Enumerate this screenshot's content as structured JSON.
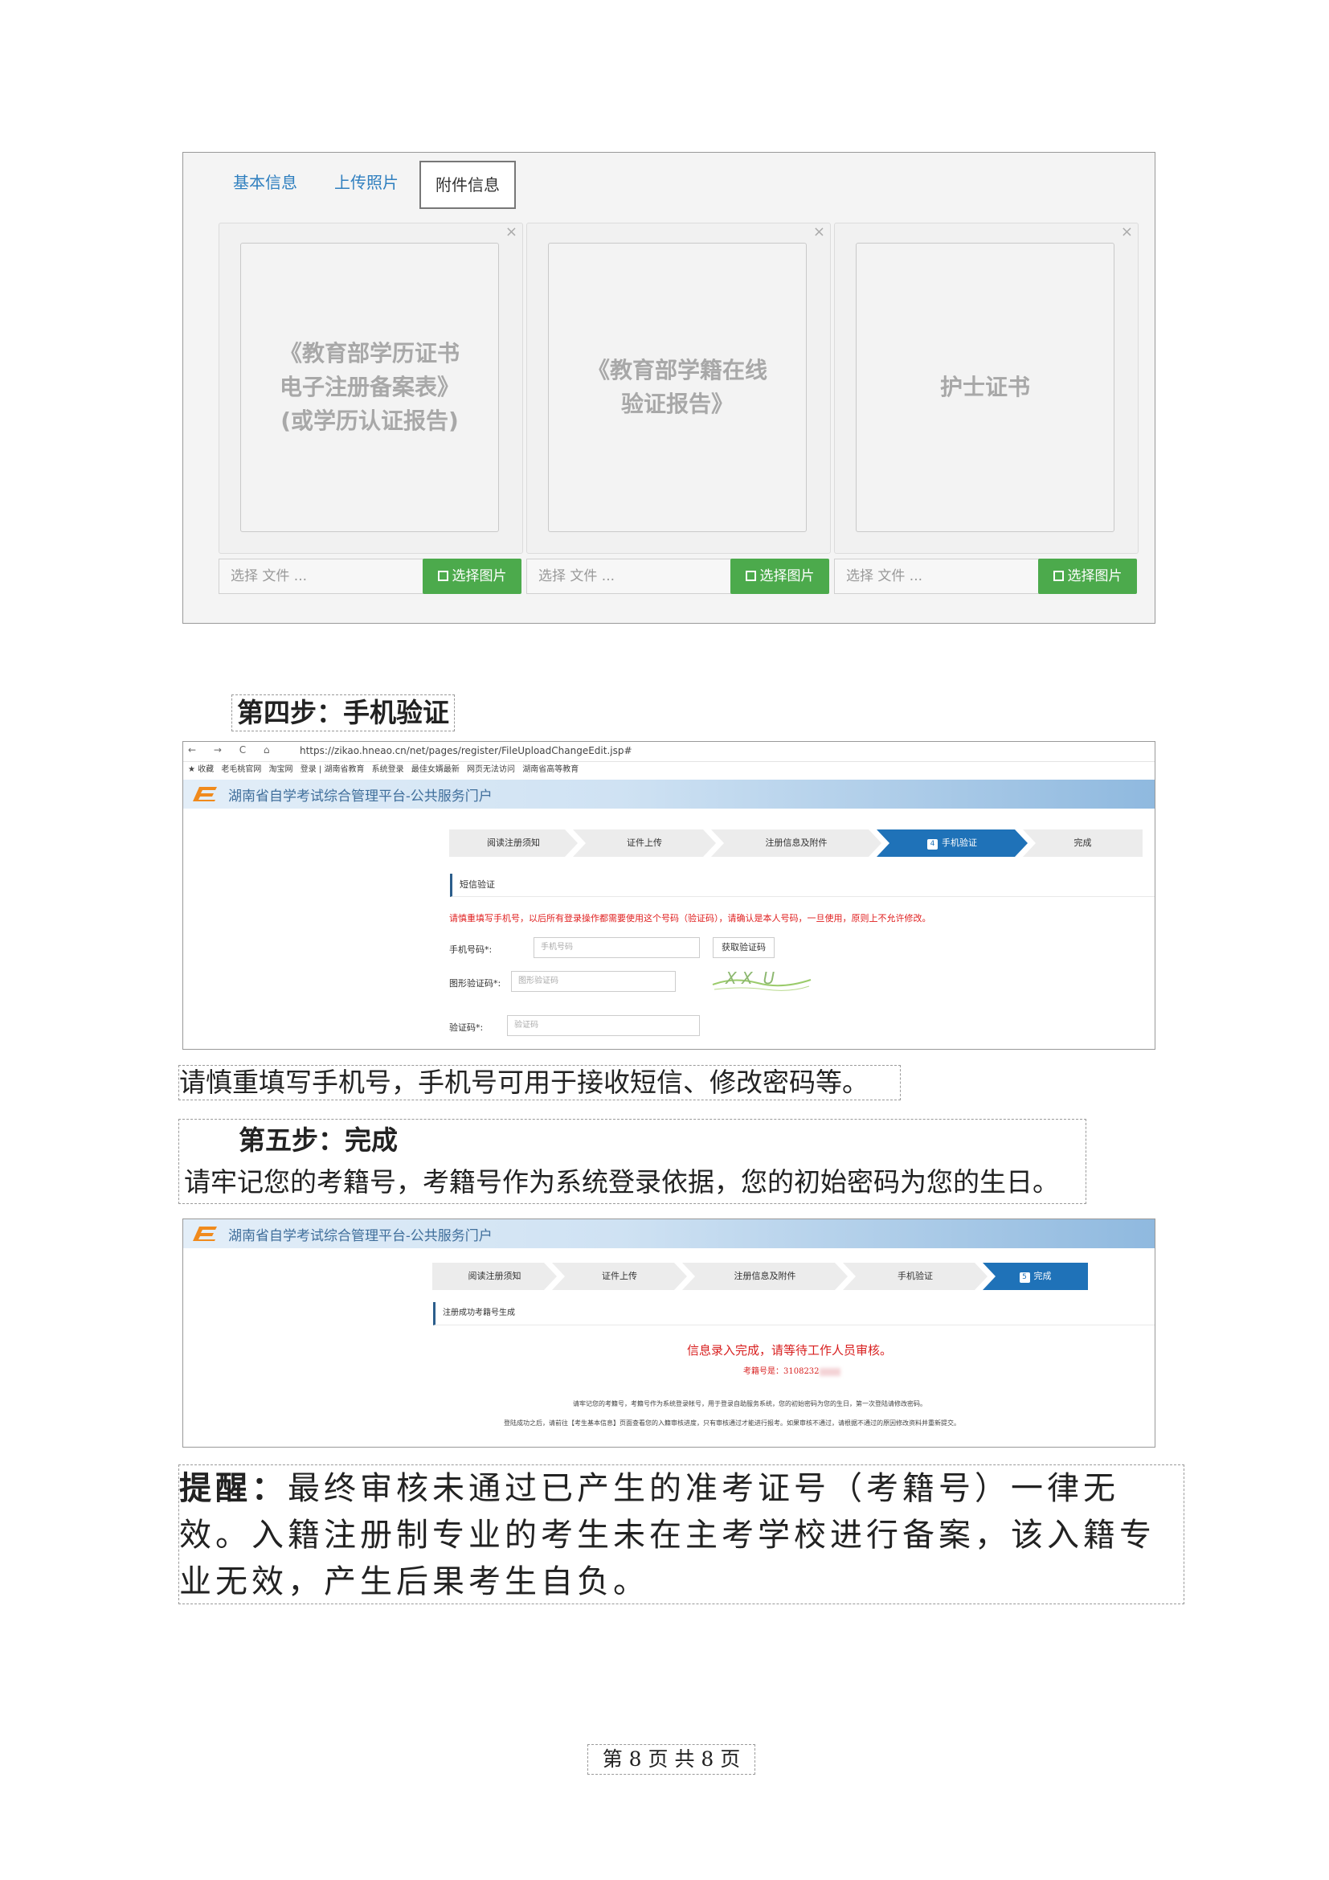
{
  "upload_panel": {
    "tabs": [
      "基本信息",
      "上传照片",
      "附件信息"
    ],
    "cards": [
      {
        "placeholder": "《教育部学历证书\n电子注册备案表》\n(或学历认证报告)"
      },
      {
        "placeholder": "《教育部学籍在线\n验证报告》"
      },
      {
        "placeholder": "护士证书"
      }
    ],
    "close_symbol": "×",
    "file_input_placeholder": "选择 文件 ...",
    "select_image_button": "选择图片"
  },
  "step4": {
    "heading": "第四步：手机验证",
    "browser": {
      "url": "https://zikao.hneao.cn/net/pages/register/FileUploadChangeEdit.jsp#",
      "nav_icons": "← → C ⌂",
      "bookmarks": [
        "★ 收藏",
        "老毛桃官网",
        "淘宝网",
        "登录 | 湖南省教育",
        "系统登录",
        "最佳女婿最新",
        "网页无法访问",
        "湖南省高等教育"
      ]
    },
    "site_title": "湖南省自学考试综合管理平台-公共服务门户",
    "steps": [
      "阅读注册须知",
      "证件上传",
      "注册信息及附件",
      "手机验证",
      "完成"
    ],
    "active_step_number": "4",
    "section_title": "短信验证",
    "warning": "请慎重填写手机号，以后所有登录操作都需要使用这个号码（验证码），请确认是本人号码，一旦使用，原则上不允许修改。",
    "fields": [
      {
        "label": "手机号码*:",
        "placeholder": "手机号码"
      },
      {
        "label": "图形验证码*:",
        "placeholder": "图形验证码"
      },
      {
        "label": "验证码*:",
        "placeholder": "验证码"
      }
    ],
    "get_code_button": "获取验证码",
    "captcha_text": "X X  U",
    "note": "请慎重填写手机号，手机号可用于接收短信、修改密码等。"
  },
  "step5": {
    "heading": "第五步：完成",
    "note": "请牢记您的考籍号，考籍号作为系统登录依据，您的初始密码为您的生日。",
    "site_title": "湖南省自学考试综合管理平台-公共服务门户",
    "steps": [
      "阅读注册须知",
      "证件上传",
      "注册信息及附件",
      "手机验证",
      "完成"
    ],
    "active_step_number": "5",
    "section_title": "注册成功考籍号生成",
    "success_message": "信息录入完成，请等待工作人员审核。",
    "exam_number_label": "考籍号是：",
    "exam_number_value": "3108232",
    "info_line_1": "请牢记您的考籍号，考籍号作为系统登录帐号，用于登录自助服务系统，您的初始密码为您的生日，第一次登陆请修改密码。",
    "info_line_2": "登陆成功之后，请前往【考生基本信息】页面查看您的入籍审核进度，只有审核通过才能进行报考。如果审核不通过，请根据不通过的原因修改资料并重新提交。"
  },
  "reminder": {
    "label": "提醒：",
    "text": "最终审核未通过已产生的准考证号（考籍号）一律无效。入籍注册制专业的考生未在主考学校进行备案，该入籍专业无效，产生后果考生自负。"
  },
  "footer": {
    "page_text": "第 8 页 共 8 页"
  },
  "colors": {
    "link_blue": "#2f7fbf",
    "success_green": "#4caa4c",
    "active_step_blue": "#1f72b8",
    "warning_red": "#e02020"
  }
}
